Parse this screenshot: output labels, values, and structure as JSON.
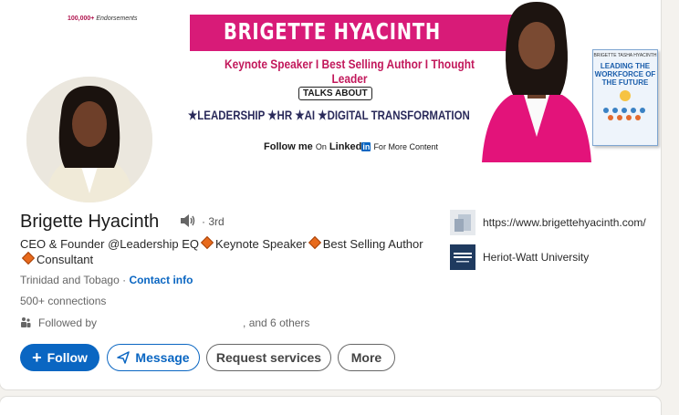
{
  "banner": {
    "endorsements_count": "100,000+",
    "endorsements_label": "Endorsements",
    "name": "BRIGETTE HYACINTH",
    "tagline": "Keynote Speaker I Best Selling Author I Thought Leader",
    "talks_about": "TALKS ABOUT",
    "topics": "★LEADERSHIP ★HR ★AI ★DIGITAL TRANSFORMATION",
    "follow_me": "Follow me",
    "follow_on": "On",
    "follow_linked": "Linked",
    "follow_in": "in",
    "follow_more": "For More Content",
    "book_author": "BRIGETTE TASHA HYACINTH",
    "book_title": "LEADING THE WORKFORCE OF THE FUTURE"
  },
  "profile": {
    "name": "Brigette Hyacinth",
    "degree": "· 3rd",
    "headline_parts": [
      "CEO & Founder @Leadership EQ",
      "Keynote Speaker",
      "Best Selling Author",
      "Consultant"
    ],
    "location": "Trinidad and Tobago ·",
    "contact_info": "Contact info",
    "connections": "500+ connections",
    "followed_by_prefix": "Followed by",
    "followed_by_suffix": ", and 6 others"
  },
  "actions": {
    "follow": "Follow",
    "message": "Message",
    "request_services": "Request services",
    "more": "More"
  },
  "sidebar": {
    "website": "https://www.brigettehyacinth.com/",
    "education": "Heriot-Watt University"
  },
  "colors": {
    "brand_pink": "#d81b78",
    "linkedin_blue": "#0a66c2",
    "diamond_orange": "#e86a1c"
  }
}
